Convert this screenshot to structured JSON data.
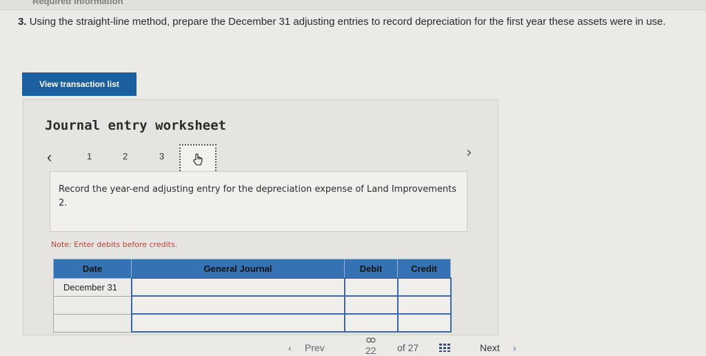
{
  "header": {
    "tab_label": "Required information"
  },
  "question": {
    "number": "3.",
    "text": "Using the straight-line method, prepare the December 31 adjusting entries to record depreciation for the first year these assets were in use."
  },
  "buttons": {
    "view_transaction_list": "View transaction list"
  },
  "worksheet": {
    "title": "Journal entry worksheet",
    "pages": [
      "1",
      "2",
      "3"
    ],
    "current_page_icon": "pointer-hand-icon",
    "instruction": "Record the year-end adjusting entry for the depreciation expense of Land Improvements 2.",
    "note": "Note: Enter debits before credits.",
    "table": {
      "headers": {
        "date": "Date",
        "general_journal": "General Journal",
        "debit": "Debit",
        "credit": "Credit"
      },
      "rows": [
        {
          "date": "December 31",
          "account": "",
          "debit": "",
          "credit": ""
        },
        {
          "date": "",
          "account": "",
          "debit": "",
          "credit": ""
        },
        {
          "date": "",
          "account": "",
          "debit": "",
          "credit": ""
        }
      ]
    }
  },
  "footer": {
    "prev_label": "Prev",
    "current_page": "22",
    "of_label": "of 27",
    "next_label": "Next"
  },
  "colors": {
    "primary_button": "#1b5f9e",
    "table_header": "#3472b4",
    "note_text": "#b0453b"
  }
}
